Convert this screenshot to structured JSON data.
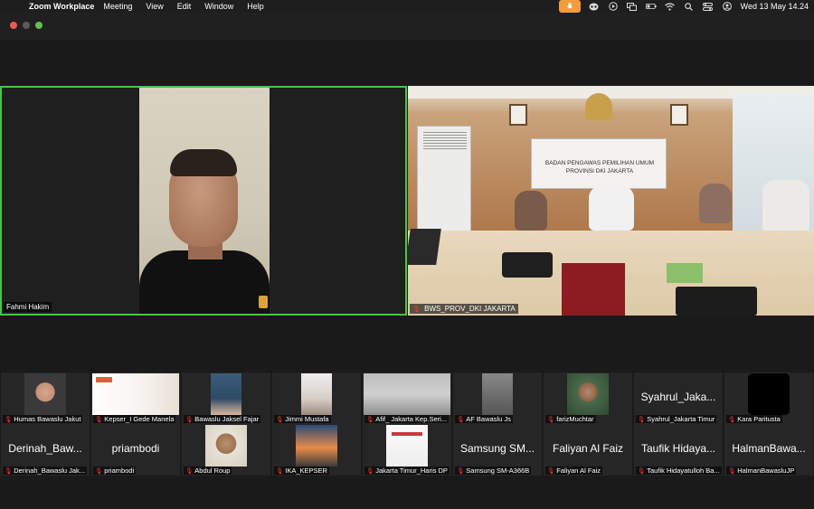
{
  "menubar": {
    "app_name": "Zoom Workplace",
    "menus": [
      "Meeting",
      "View",
      "Edit",
      "Window",
      "Help"
    ],
    "clock": "Wed 13 May  14.24"
  },
  "speaker_tile": {
    "name": "Fahmi Hakim"
  },
  "room_tile": {
    "name": "BWS_PROV_DKI JAKARTA",
    "sign_line1": "BADAN PENGAWAS PEMILIHAN UMUM",
    "sign_line2": "PROVINSI DKI JAKARTA"
  },
  "gallery": {
    "row1": [
      {
        "label": "Humas Bawaslu Jakut"
      },
      {
        "label": "Kepser_I Gede Manela"
      },
      {
        "label": "Bawaslu Jaksel Fajar"
      },
      {
        "label": "Jimmi Mustafa"
      },
      {
        "label": "Afif_ Jakarta Kep.Seri..."
      },
      {
        "label": "AF Bawaslu Js"
      },
      {
        "label": "farizMuchtar"
      },
      {
        "label": "Syahrul_Jakarta Timur",
        "big": "Syahrul_Jaka..."
      },
      {
        "label": "Kara Paritusta"
      }
    ],
    "row2": [
      {
        "label": "Derinah_Bawaslu Jak...",
        "big": "Derinah_Baw..."
      },
      {
        "label": "priambodi",
        "big": "priambodi"
      },
      {
        "label": "Abdul Roup"
      },
      {
        "label": "IKA_KEPSER"
      },
      {
        "label": "Jakarta Timur_Haris DP"
      },
      {
        "label": "Samsung SM-A366B",
        "big": "Samsung SM..."
      },
      {
        "label": "Faliyan Al Faiz",
        "big": "Faliyan Al Faiz"
      },
      {
        "label": "Taufik Hidayatulloh Ba...",
        "big": "Taufik Hidaya..."
      },
      {
        "label": "HalmanBawasluJP",
        "big": "HalmanBawa..."
      }
    ]
  },
  "colors": {
    "active_speaker_border": "#4bc24b",
    "mic_off": "#ff3b30",
    "menubar_mic": "#f39c3c"
  }
}
